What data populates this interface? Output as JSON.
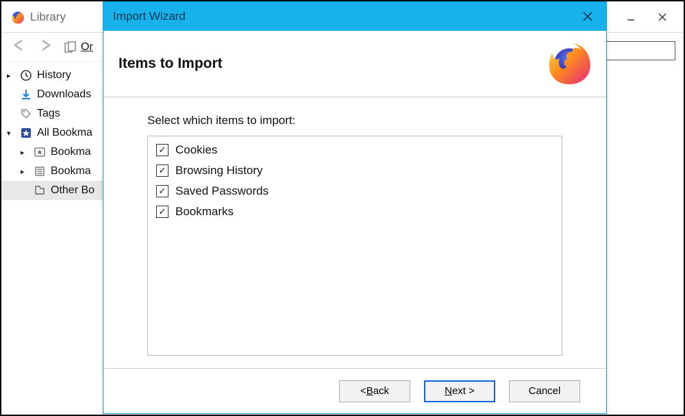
{
  "library": {
    "title": "Library",
    "organize_label": "Or",
    "sidebar": {
      "history": "History",
      "downloads": "Downloads",
      "tags": "Tags",
      "all_bookmarks": "All Bookma",
      "bookmarks_toolbar": "Bookma",
      "bookmarks_menu": "Bookma",
      "other_bookmarks": "Other Bo"
    }
  },
  "wizard": {
    "title": "Import Wizard",
    "heading": "Items to Import",
    "select_label": "Select which items to import:",
    "items": [
      {
        "label": "Cookies",
        "checked": true
      },
      {
        "label": "Browsing History",
        "checked": true
      },
      {
        "label": "Saved Passwords",
        "checked": true
      },
      {
        "label": "Bookmarks",
        "checked": true
      }
    ],
    "buttons": {
      "back_prefix": "< ",
      "back_underline": "B",
      "back_rest": "ack",
      "next_underline": "N",
      "next_rest": "ext >",
      "cancel": "Cancel"
    }
  }
}
